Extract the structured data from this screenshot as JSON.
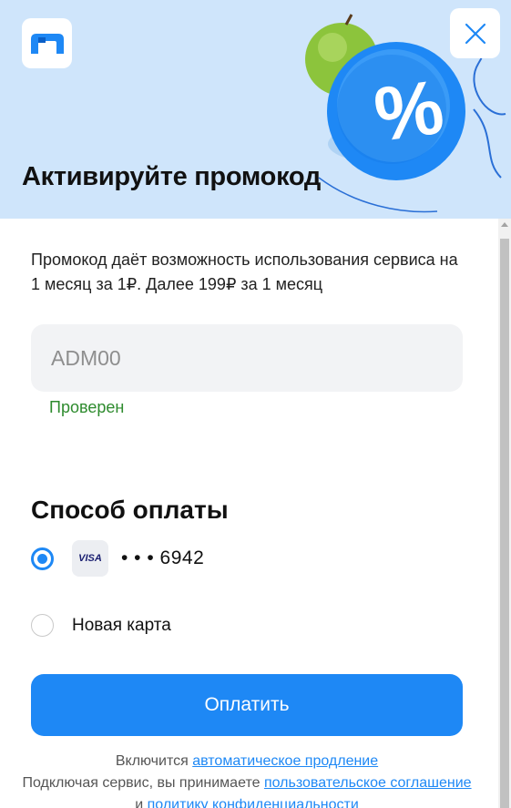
{
  "header": {
    "title": "Активируйте промокод",
    "logo_icon": "service-logo-icon",
    "close_icon": "close-icon"
  },
  "promo": {
    "description": "Промокод даёт возможность использования сервиса на 1 месяц за 1₽. Далее 199₽ за 1 месяц",
    "code_value": "ADM00",
    "status": "Проверен"
  },
  "payment": {
    "title": "Способ оплаты",
    "options": [
      {
        "brand": "VISA",
        "card_mask": "• • • 6942",
        "selected": true
      },
      {
        "label": "Новая карта",
        "selected": false
      }
    ],
    "pay_button": "Оплатить"
  },
  "legal": {
    "line1_prefix": "Включится",
    "line1_link": "автоматическое продление",
    "line2_prefix": "Подключая сервис, вы принимаете",
    "line2_link1": "пользовательское соглашение",
    "line2_and": "и",
    "line2_link2": "политику конфиденциальности"
  },
  "colors": {
    "accent": "#1e88f5",
    "hero_bg": "#cfe5fb",
    "success": "#2e8b2e"
  }
}
